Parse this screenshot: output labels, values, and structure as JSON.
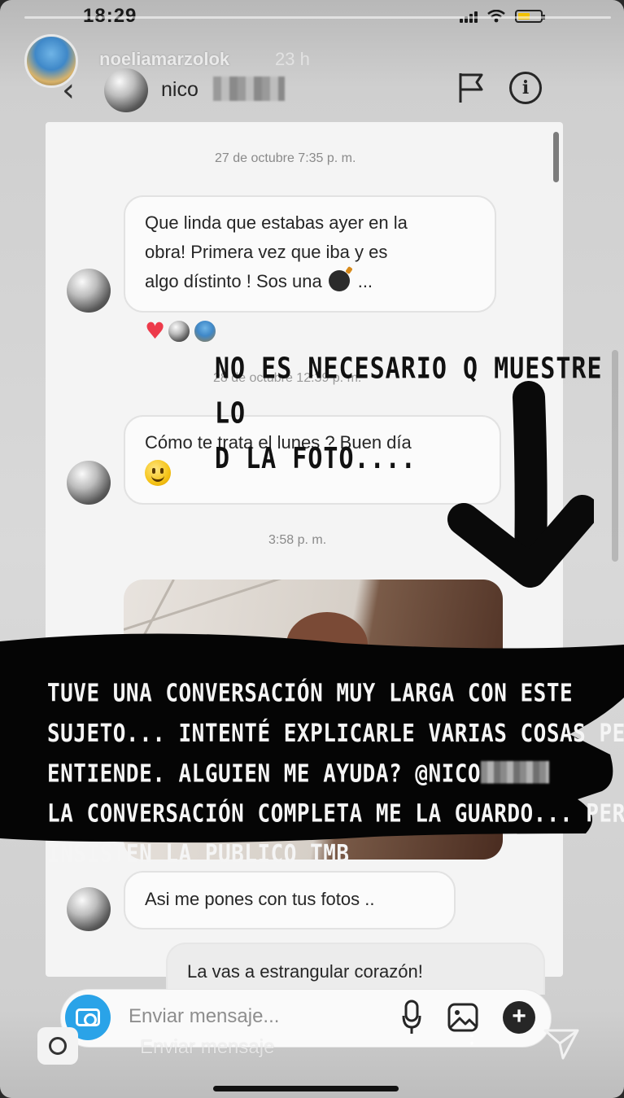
{
  "status_bar": {
    "time": "18:29"
  },
  "story": {
    "username": "noeliamarzolok",
    "time_ago": "23 h",
    "reply_placeholder": "Enviar mensaje"
  },
  "dm": {
    "contact_name_visible": "nico",
    "icons": [
      "back-arrow-icon",
      "flag-icon",
      "info-icon"
    ]
  },
  "messages": [
    {
      "type": "timestamp",
      "text": "27 de octubre 7:35 p. m."
    },
    {
      "type": "incoming",
      "lines": [
        "Que linda que estabas ayer en la",
        "obra! Primera vez que iba y es",
        "algo dístinto ! Sos una"
      ],
      "suffix": "...",
      "emoji": "bomb-icon",
      "reactions": [
        "heart-icon",
        "avatar",
        "avatar"
      ]
    },
    {
      "type": "timestamp",
      "text": "28 de octubre 12:39 p. m."
    },
    {
      "type": "incoming",
      "lines": [
        "Cómo te trata el lunes ? Buen día"
      ],
      "emoji": "smiley-icon"
    },
    {
      "type": "timestamp",
      "text": "3:58 p. m."
    },
    {
      "type": "incoming-photo"
    },
    {
      "type": "incoming",
      "lines": [
        "Asi me pones con tus fotos .."
      ]
    },
    {
      "type": "outgoing",
      "lines": [
        "La vas a estrangular corazón!"
      ]
    }
  ],
  "annotations": {
    "top_lines": [
      "NO ES NECESARIO Q MUESTRE LO",
      "D LA FOTO...."
    ],
    "band_lines": [
      "TUVE UNA CONVERSACIÓN MUY LARGA CON ESTE",
      "SUJETO... INTENTÉ EXPLICARLE VARIAS COSAS PERO NO",
      "ENTIENDE. ALGUIEN ME AYUDA? @NICO",
      "LA CONVERSACIÓN COMPLETA ME LA GUARDO... PERO SI",
      "INSISTEN LA PUBLICO TMB"
    ]
  },
  "composer": {
    "placeholder": "Enviar mensaje...",
    "icons": [
      "camera-icon",
      "microphone-icon",
      "gallery-icon",
      "plus-icon"
    ]
  },
  "colors": {
    "camera_button": "#2aa3e8",
    "heart": "#ed3a4a",
    "battery": "#f2c200"
  }
}
